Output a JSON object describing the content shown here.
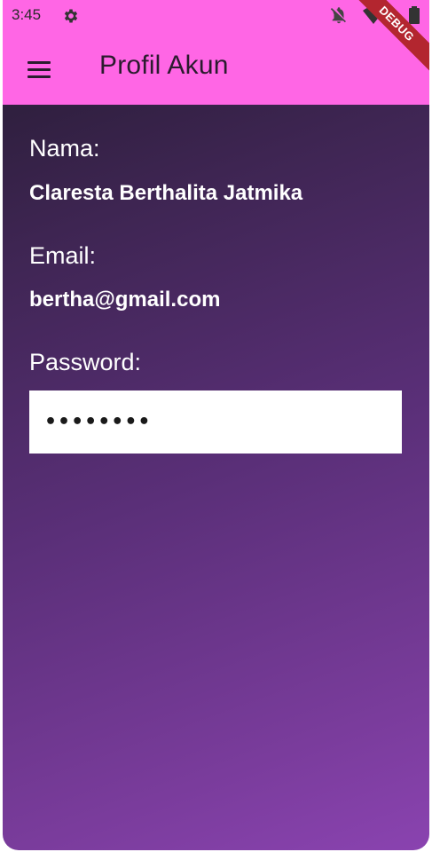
{
  "status_bar": {
    "time": "3:45",
    "icons": [
      "gear-icon",
      "notifications-off-icon",
      "wifi-icon",
      "signal-icon",
      "battery-icon"
    ]
  },
  "app_bar": {
    "title": "Profil Akun",
    "menu_icon": "menu-icon",
    "debug_banner": "DEBUG"
  },
  "profile": {
    "name_label": "Nama:",
    "name_value": "Claresta Berthalita Jatmika",
    "email_label": "Email:",
    "email_value": "bertha@gmail.com",
    "password_label": "Password:",
    "password_value": "••••••••"
  },
  "colors": {
    "app_bar": "#ff66e5",
    "gradient_top": "#241b30",
    "gradient_bottom": "#8a43b0",
    "debug_banner": "#b3262f"
  }
}
